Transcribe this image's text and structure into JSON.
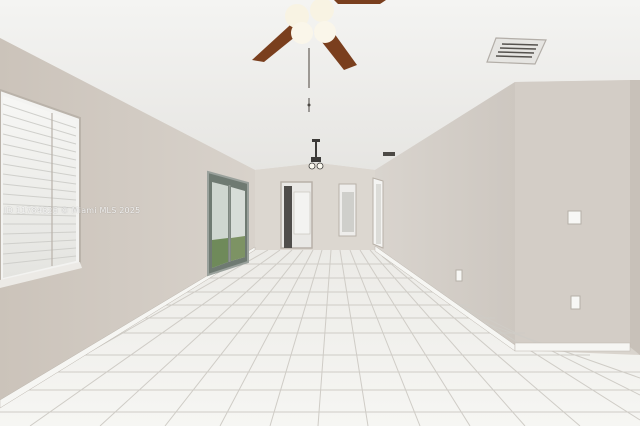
{
  "photo": {
    "kind": "interior-real-estate-photo",
    "room": "empty living room",
    "watermark_text": "ID 11784626 © Miami MLS 2025"
  },
  "colors": {
    "ceiling": "#f1f1ef",
    "wall_left": "#cfc8c0",
    "wall_right": "#d4cec7",
    "floor_tile": "#f2f2ef",
    "grout": "#c9c6c0",
    "baseboard": "#f5f5f2",
    "fan_blade": "#7a3f1e",
    "window_blinds": "#efefec"
  }
}
